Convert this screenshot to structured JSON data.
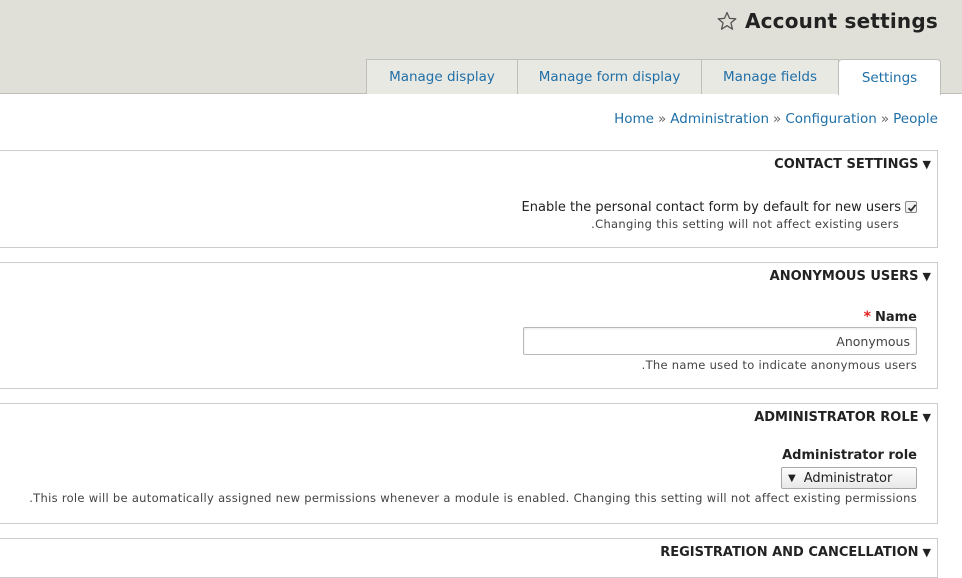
{
  "header": {
    "title": "Account settings",
    "star_icon": "star-outline-icon"
  },
  "tabs": [
    {
      "label": "Manage display",
      "active": false
    },
    {
      "label": "Manage form display",
      "active": false
    },
    {
      "label": "Manage fields",
      "active": false
    },
    {
      "label": "Settings",
      "active": true
    }
  ],
  "breadcrumb": {
    "items": [
      "Home",
      "Administration",
      "Configuration",
      "People"
    ],
    "separator": "»"
  },
  "contact_settings": {
    "legend": "CONTACT SETTINGS",
    "checkbox_label": "Enable the personal contact form by default for new users",
    "checked": true,
    "description": ".Changing this setting will not affect existing users"
  },
  "anonymous_users": {
    "legend": "ANONYMOUS USERS",
    "name_label": "Name",
    "required_marker": "*",
    "name_value": "Anonymous",
    "description": ".The name used to indicate anonymous users"
  },
  "administrator_role": {
    "legend": "ADMINISTRATOR ROLE",
    "field_label": "Administrator role",
    "selected": "Administrator",
    "description": ".This role will be automatically assigned new permissions whenever a module is enabled. Changing this setting will not affect existing permissions"
  },
  "registration": {
    "legend": "REGISTRATION AND CANCELLATION"
  },
  "colors": {
    "link": "#1f6fa7",
    "header_bg": "#e0e0d8",
    "required": "#e02020"
  }
}
